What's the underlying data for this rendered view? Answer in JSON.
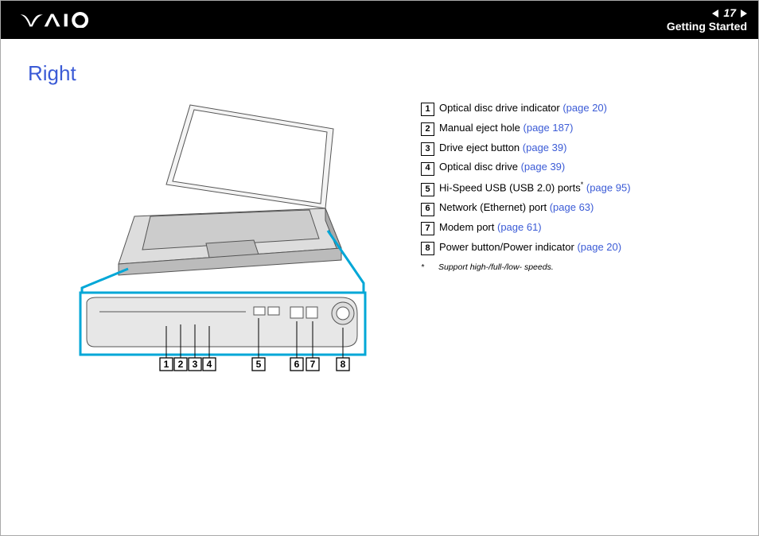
{
  "header": {
    "page": "17",
    "section": "Getting Started"
  },
  "title": "Right",
  "definitions": [
    {
      "n": "1",
      "text": "Optical disc drive indicator ",
      "link": "(page 20)"
    },
    {
      "n": "2",
      "text": "Manual eject hole ",
      "link": "(page 187)"
    },
    {
      "n": "3",
      "text": "Drive eject button ",
      "link": "(page 39)"
    },
    {
      "n": "4",
      "text": "Optical disc drive ",
      "link": "(page 39)"
    },
    {
      "n": "5",
      "text": "Hi-Speed USB (USB 2.0) ports",
      "sup": "*",
      "post": " ",
      "link": "(page 95)"
    },
    {
      "n": "6",
      "text": "Network (Ethernet) port ",
      "link": "(page 63)"
    },
    {
      "n": "7",
      "text": "Modem port ",
      "link": "(page 61)"
    },
    {
      "n": "8",
      "text": "Power button/Power indicator ",
      "link": "(page 20)"
    }
  ],
  "footnote": {
    "mark": "*",
    "text": "Support high-/full-/low- speeds."
  },
  "labels": [
    "1",
    "2",
    "3",
    "4",
    "5",
    "6",
    "7",
    "8"
  ]
}
